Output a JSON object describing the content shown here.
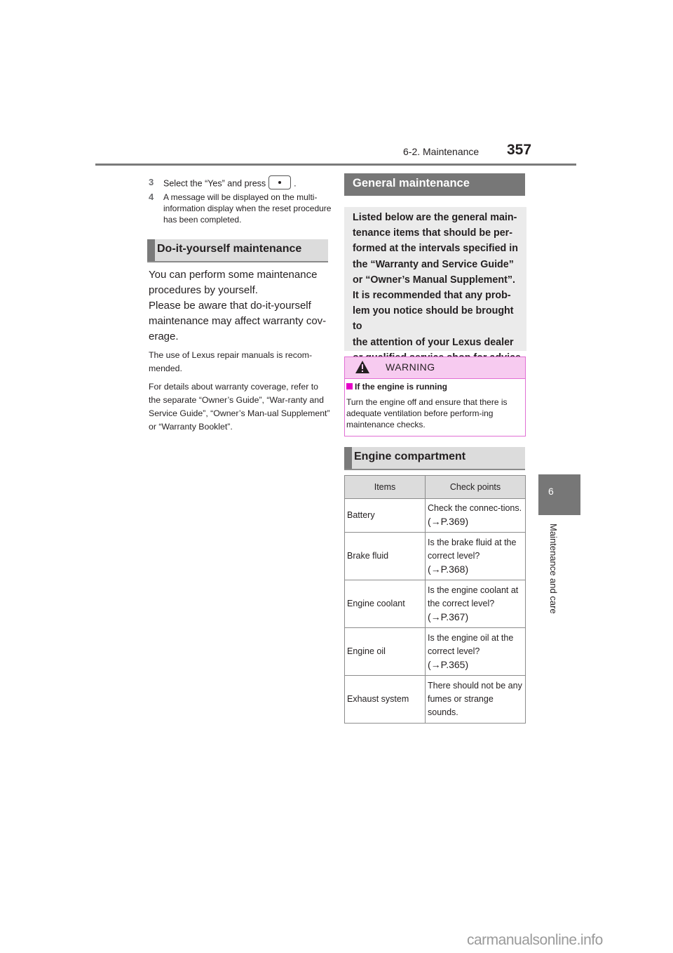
{
  "header": {
    "section": "6-2. Maintenance",
    "page_number": "357"
  },
  "steps": [
    {
      "num": "3",
      "text_before": "Select the “Yes” and press",
      "button_icon": "enter-dot-icon",
      "text_after": "."
    },
    {
      "num": "4",
      "text": "A message will be displayed on the multi-information display when the reset procedure has been completed."
    }
  ],
  "diy": {
    "title": "Do-it-yourself maintenance",
    "paragraph_lines": [
      "You can perform some maintenance",
      "procedures by yourself.",
      "Please be aware that do-it-yourself",
      "maintenance may affect warranty cov-",
      "erage."
    ],
    "note1": "The use of Lexus repair manuals is recom-mended.",
    "note2": "For details about warranty coverage, refer to the separate “Owner’s Guide”, “War-ranty and Service Guide”, “Owner’s Man-ual Supplement” or “Warranty Booklet”."
  },
  "general": {
    "title": "General maintenance",
    "intro_lines": [
      "Listed below are the general main-",
      "tenance items that should be per-",
      "formed at the intervals specified in",
      "the “Warranty and Service Guide”",
      "or “Owner’s Manual Supplement”.",
      "It is recommended that any prob-",
      "lem you notice should be brought to",
      "the attention of your Lexus dealer",
      "or qualified service shop for advice."
    ]
  },
  "warning": {
    "icon": "warning-triangle-icon",
    "title": "WARNING",
    "subtitle": "If the engine is running",
    "body": "Turn the engine off and ensure that there is adequate ventilation before perform-ing maintenance checks.",
    "accent_color": "#e600c8"
  },
  "engine": {
    "title": "Engine compartment",
    "columns": [
      "Items",
      "Check points"
    ],
    "rows": [
      {
        "item": "Battery",
        "check": "Check the connec-tions.",
        "ref": "(→P.369)"
      },
      {
        "item": "Brake fluid",
        "check": "Is the brake fluid at the correct level?",
        "ref": "(→P.368)"
      },
      {
        "item": "Engine coolant",
        "check": "Is the engine coolant at the correct level?",
        "ref": "(→P.367)"
      },
      {
        "item": "Engine oil",
        "check": "Is the engine oil at the correct level?",
        "ref": "(→P.365)"
      },
      {
        "item": "Exhaust system",
        "check": "There should not be any fumes or strange sounds.",
        "ref": ""
      }
    ]
  },
  "side_tab": {
    "chapter": "6",
    "label": "Maintenance and care"
  },
  "watermark": "carmanualsonline.info"
}
